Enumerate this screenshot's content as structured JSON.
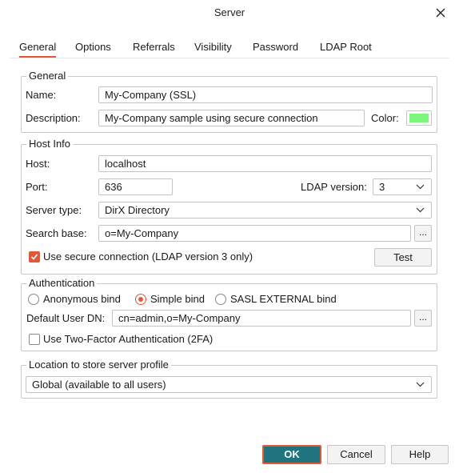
{
  "window": {
    "title": "Server"
  },
  "tabs": [
    {
      "label": "General"
    },
    {
      "label": "Options"
    },
    {
      "label": "Referrals"
    },
    {
      "label": "Visibility"
    },
    {
      "label": "Password"
    },
    {
      "label": "LDAP Root"
    }
  ],
  "general": {
    "legend": "General",
    "name_label": "Name:",
    "name_value": "My-Company (SSL)",
    "description_label": "Description:",
    "description_value": "My-Company sample using secure connection",
    "color_label": "Color:",
    "color_value": "#7cf57c"
  },
  "host_info": {
    "legend": "Host Info",
    "host_label": "Host:",
    "host_value": "localhost",
    "port_label": "Port:",
    "port_value": "636",
    "ldap_version_label": "LDAP version:",
    "ldap_version_value": "3",
    "server_type_label": "Server type:",
    "server_type_value": "DirX Directory",
    "search_base_label": "Search base:",
    "search_base_value": "o=My-Company",
    "browse_label": "...",
    "secure_label": "Use secure connection (LDAP version 3 only)",
    "secure_checked": true,
    "test_label": "Test"
  },
  "authentication": {
    "legend": "Authentication",
    "options": [
      "Anonymous bind",
      "Simple bind",
      "SASL EXTERNAL bind"
    ],
    "selected": "Simple bind",
    "default_dn_label": "Default User DN:",
    "default_dn_value": "cn=admin,o=My-Company",
    "browse_label": "...",
    "twofa_label": "Use Two-Factor Authentication (2FA)",
    "twofa_checked": false
  },
  "location": {
    "legend": "Location to store server profile",
    "value": "Global (available to all users)"
  },
  "buttons": {
    "ok": "OK",
    "cancel": "Cancel",
    "help": "Help"
  },
  "colors": {
    "accent": "#e05a3a",
    "primary": "#1f7480"
  }
}
